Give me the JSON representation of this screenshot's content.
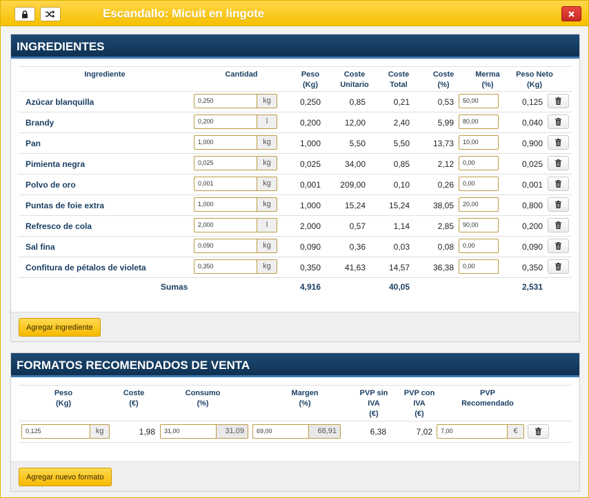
{
  "window": {
    "title": "Escandallo: Micuit en lingote",
    "lock_icon": "lock-icon",
    "shuffle_icon": "shuffle-icon",
    "close_icon": "close-icon"
  },
  "ingredients": {
    "heading": "INGREDIENTES",
    "headers": {
      "ingrediente": "Ingrediente",
      "cantidad": "Cantidad",
      "peso_1": "Peso",
      "peso_2": "(Kg)",
      "coste_unitario_1": "Coste",
      "coste_unitario_2": "Unitario",
      "coste_total_1": "Coste",
      "coste_total_2": "Total",
      "coste_pct_1": "Coste",
      "coste_pct_2": "(%)",
      "merma_1": "Merma",
      "merma_2": "(%)",
      "peso_neto_1": "Peso Neto",
      "peso_neto_2": "(Kg)"
    },
    "rows": [
      {
        "name": "Azúcar blanquilla",
        "cantidad": "0,250",
        "unit": "kg",
        "peso": "0,250",
        "coste_unitario": "0,85",
        "coste_total": "0,21",
        "coste_pct": "0,53",
        "merma": "50,00",
        "peso_neto": "0,125"
      },
      {
        "name": "Brandy",
        "cantidad": "0,200",
        "unit": "l",
        "peso": "0,200",
        "coste_unitario": "12,00",
        "coste_total": "2,40",
        "coste_pct": "5,99",
        "merma": "80,00",
        "peso_neto": "0,040"
      },
      {
        "name": "Pan",
        "cantidad": "1,000",
        "unit": "kg",
        "peso": "1,000",
        "coste_unitario": "5,50",
        "coste_total": "5,50",
        "coste_pct": "13,73",
        "merma": "10,00",
        "peso_neto": "0,900"
      },
      {
        "name": "Pimienta negra",
        "cantidad": "0,025",
        "unit": "kg",
        "peso": "0,025",
        "coste_unitario": "34,00",
        "coste_total": "0,85",
        "coste_pct": "2,12",
        "merma": "0,00",
        "peso_neto": "0,025"
      },
      {
        "name": "Polvo de oro",
        "cantidad": "0,001",
        "unit": "kg",
        "peso": "0,001",
        "coste_unitario": "209,00",
        "coste_total": "0,10",
        "coste_pct": "0,26",
        "merma": "0,00",
        "peso_neto": "0,001"
      },
      {
        "name": "Puntas de foie extra",
        "cantidad": "1,000",
        "unit": "kg",
        "peso": "1,000",
        "coste_unitario": "15,24",
        "coste_total": "15,24",
        "coste_pct": "38,05",
        "merma": "20,00",
        "peso_neto": "0,800"
      },
      {
        "name": "Refresco de cola",
        "cantidad": "2,000",
        "unit": "l",
        "peso": "2,000",
        "coste_unitario": "0,57",
        "coste_total": "1,14",
        "coste_pct": "2,85",
        "merma": "90,00",
        "peso_neto": "0,200"
      },
      {
        "name": "Sal fina",
        "cantidad": "0,090",
        "unit": "kg",
        "peso": "0,090",
        "coste_unitario": "0,36",
        "coste_total": "0,03",
        "coste_pct": "0,08",
        "merma": "0,00",
        "peso_neto": "0,090"
      },
      {
        "name": "Confitura de pétalos de violeta",
        "cantidad": "0,350",
        "unit": "kg",
        "peso": "0,350",
        "coste_unitario": "41,63",
        "coste_total": "14,57",
        "coste_pct": "36,38",
        "merma": "0,00",
        "peso_neto": "0,350"
      }
    ],
    "sums": {
      "label": "Sumas",
      "peso": "4,916",
      "coste_total": "40,05",
      "peso_neto": "2,531"
    },
    "add_button": "Agregar ingrediente",
    "trash_icon": "trash-icon"
  },
  "formats": {
    "heading": "FORMATOS RECOMENDADOS DE VENTA",
    "headers": {
      "peso_1": "Peso",
      "peso_2": "(Kg)",
      "coste_1": "Coste",
      "coste_2": "(€)",
      "consumo_1": "Consumo",
      "consumo_2": "(%)",
      "margen_1": "Margen",
      "margen_2": "(%)",
      "pvp_sin_1": "PVP sin",
      "pvp_sin_2": "IVA",
      "pvp_sin_3": "(€)",
      "pvp_con_1": "PVP con",
      "pvp_con_2": "IVA",
      "pvp_con_3": "(€)",
      "pvp_rec_1": "PVP",
      "pvp_rec_2": "Recomendado"
    },
    "row": {
      "peso": "0,125",
      "peso_unit": "kg",
      "coste": "1,98",
      "consumo": "31,00",
      "consumo_calc": "31,09",
      "margen": "69,00",
      "margen_calc": "68,91",
      "pvp_sin_iva": "6,38",
      "pvp_con_iva": "7,02",
      "pvp_recomendado": "7,00",
      "pvp_unit": "€"
    },
    "add_button": "Agregar nuevo formato"
  },
  "colors": {
    "titlebar": "#f7c000",
    "panel_header": "#0f3152",
    "accent_line": "#3d7ab3",
    "button_yellow": "#ffd94f",
    "close_red": "#d1342b"
  }
}
